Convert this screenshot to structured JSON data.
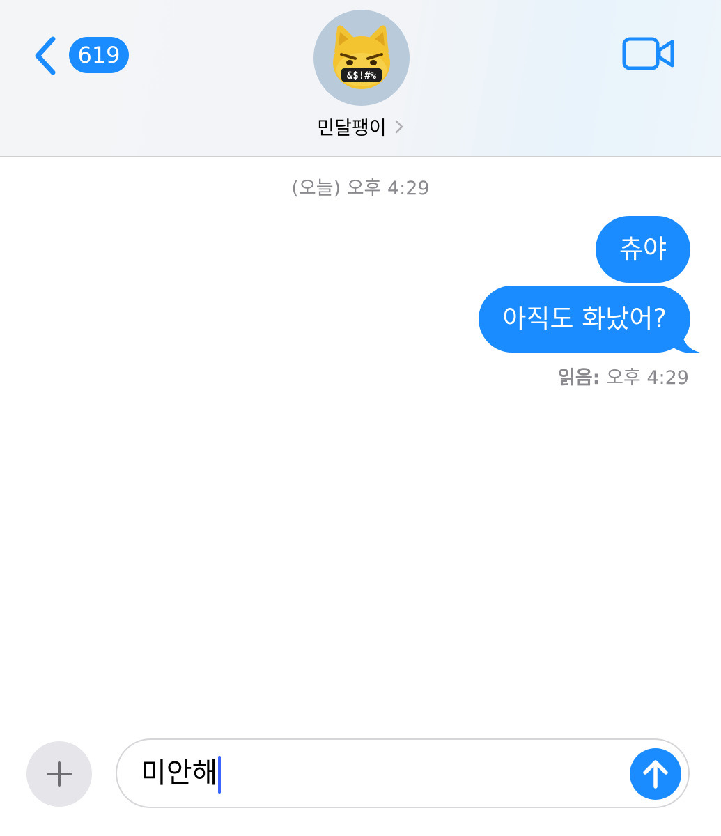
{
  "header": {
    "back_badge": "619",
    "contact_name": "민달팽이",
    "avatar_icon": "angry-cat-memoji-icon",
    "avatar_symbols": "&$!#%",
    "video_icon": "video-camera-icon"
  },
  "conversation": {
    "timestamp": "(오늘) 오후 4:29",
    "messages": [
      {
        "text": "츄야",
        "from": "me"
      },
      {
        "text": "아직도 화났어?",
        "from": "me"
      }
    ],
    "read_label": "읽음:",
    "read_time": "오후 4:29"
  },
  "composer": {
    "plus_icon": "plus-icon",
    "text": "미안해",
    "send_icon": "arrow-up-icon"
  },
  "colors": {
    "accent": "#1a8cff",
    "bubble_text": "#ffffff",
    "meta_text": "#8a8a8e",
    "caret": "#3b63ff"
  }
}
